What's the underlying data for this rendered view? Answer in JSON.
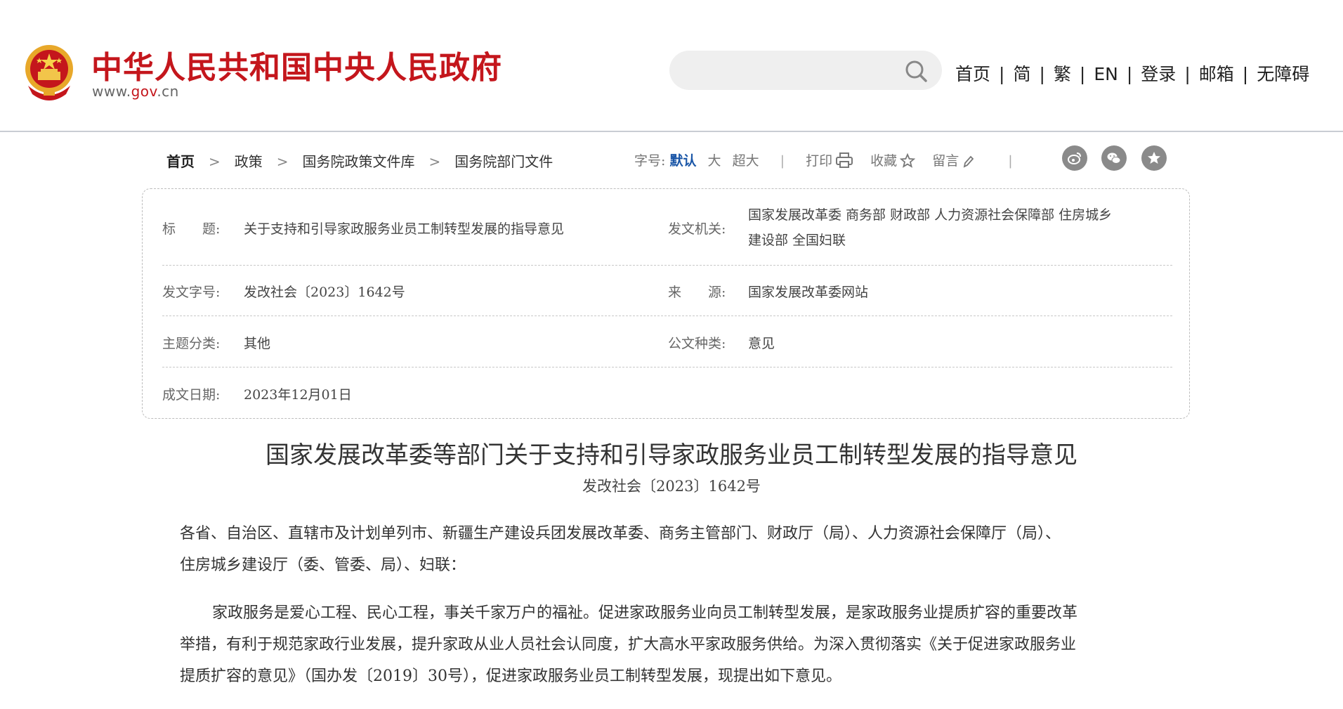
{
  "header": {
    "site_title": "中华人民共和国中央人民政府",
    "site_url_prefix": "www.",
    "site_url_brand": "gov",
    "site_url_suffix": ".cn",
    "search_placeholder": "",
    "nav": [
      "首页",
      "简",
      "繁",
      "EN",
      "登录",
      "邮箱",
      "无障碍"
    ]
  },
  "breadcrumb": [
    "首页",
    "政策",
    "国务院政策文件库",
    "国务院部门文件"
  ],
  "toolbar": {
    "font_label": "字号:",
    "font_default": "默认",
    "font_large": "大",
    "font_xlarge": "超大",
    "print": "打印",
    "favorite": "收藏",
    "comment": "留言"
  },
  "meta": {
    "title_label": "标　　题:",
    "title_value": "关于支持和引导家政服务业员工制转型发展的指导意见",
    "issuer_label": "发文机关:",
    "issuer_value_line1": "国家发展改革委 商务部 财政部 人力资源社会保障部 住房城乡",
    "issuer_value_line2": "建设部 全国妇联",
    "docnum_label": "发文字号:",
    "docnum_value": "发改社会〔2023〕1642号",
    "source_label": "来　　源:",
    "source_value": "国家发展改革委网站",
    "topic_label": "主题分类:",
    "topic_value": "其他",
    "doctype_label": "公文种类:",
    "doctype_value": "意见",
    "date_label": "成文日期:",
    "date_value": "2023年12月01日"
  },
  "article": {
    "title": "国家发展改革委等部门关于支持和引导家政服务业员工制转型发展的指导意见",
    "doc_number": "发改社会〔2023〕1642号",
    "salutation_line1": "各省、自治区、直辖市及计划单列市、新疆生产建设兵团发展改革委、商务主管部门、财政厅（局）、人力资源社会保障厅（局）、",
    "salutation_line2": "住房城乡建设厅（委、管委、局）、妇联：",
    "para1_line1": "家政服务是爱心工程、民心工程，事关千家万户的福祉。促进家政服务业向员工制转型发展，是家政服务业提质扩容的重要改革",
    "para1_line2": "举措，有利于规范家政行业发展，提升家政从业人员社会认同度，扩大高水平家政服务供给。为深入贯彻落实《关于促进家政服务业",
    "para1_line3": "提质扩容的意见》（国办发〔2019〕30号），促进家政服务业员工制转型发展，现提出如下意见。"
  },
  "icons": [
    "national-emblem",
    "search-icon",
    "print-icon",
    "star-icon",
    "pencil-icon",
    "weibo-icon",
    "wechat-icon",
    "favorite-share-icon"
  ],
  "colors": {
    "brand_red": "#c4161c",
    "link_blue": "#1a56a7",
    "share_gray": "#8a8a8a"
  }
}
